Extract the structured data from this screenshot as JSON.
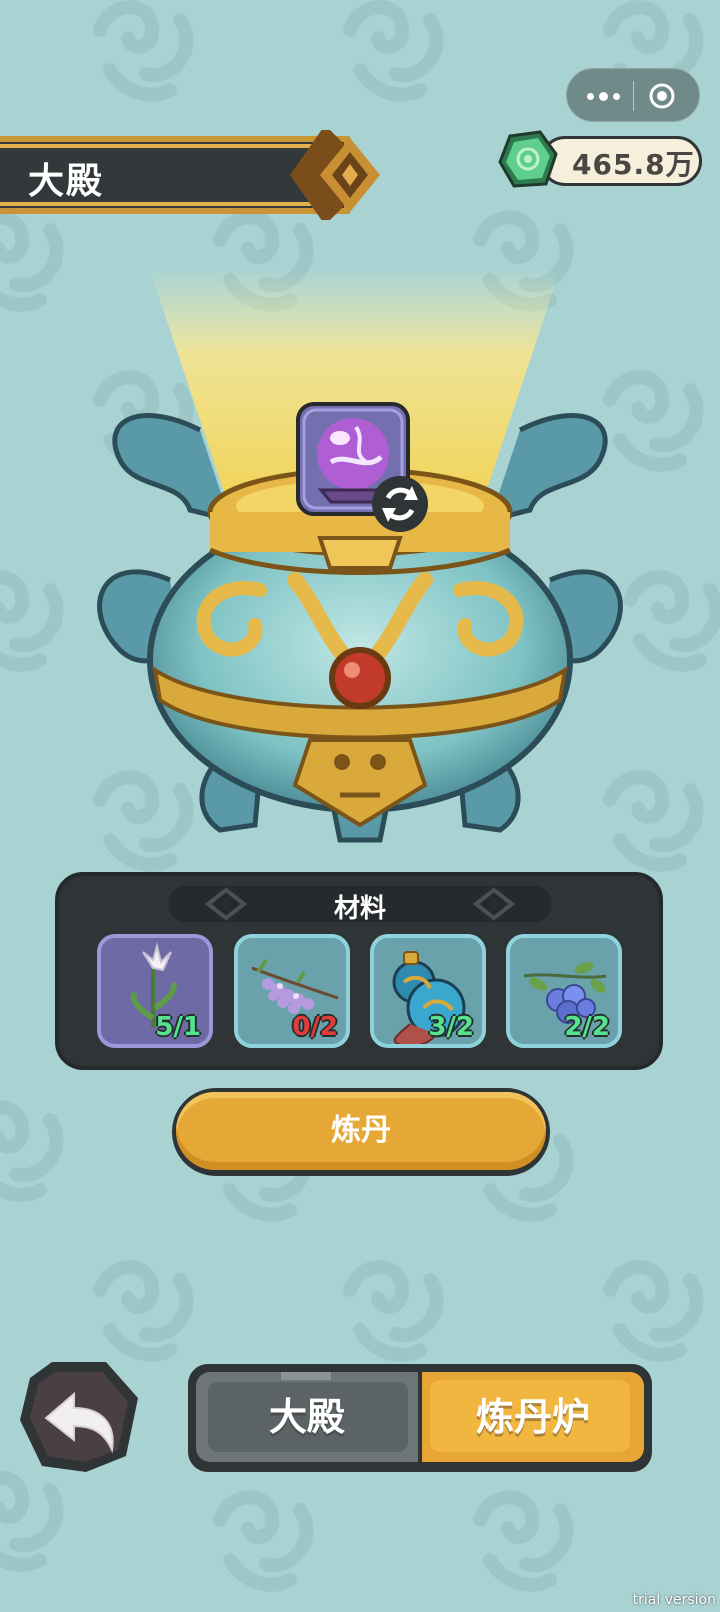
{
  "header": {
    "title": "大殿"
  },
  "capsule": {
    "more_icon": "more-dots-icon",
    "close_icon": "target-circle-icon"
  },
  "currency": {
    "value": "465.8万",
    "icon": "jade-gem-icon"
  },
  "furnace": {
    "pill_icon": "purple-pill-orb-icon",
    "swap_icon": "refresh-swap-icon"
  },
  "materials": {
    "title": "材料",
    "items": [
      {
        "icon": "white-lily-herb-icon",
        "count": "5/1",
        "count_color": "#56e38f",
        "frame": "purple"
      },
      {
        "icon": "wisteria-flower-icon",
        "count": "0/2",
        "count_color": "#e23b3b",
        "frame": "teal"
      },
      {
        "icon": "blue-gourd-bottle-icon",
        "count": "3/2",
        "count_color": "#56e38f",
        "frame": "teal"
      },
      {
        "icon": "blue-berry-branch-icon",
        "count": "2/2",
        "count_color": "#56e38f",
        "frame": "teal"
      }
    ]
  },
  "brew_button": {
    "label": "炼丹"
  },
  "back_button": {
    "icon": "back-arrow-icon"
  },
  "tabs": [
    {
      "label": "大殿",
      "active": false
    },
    {
      "label": "炼丹炉",
      "active": true
    }
  ],
  "watermark": "trial version",
  "colors": {
    "background": "#a9d3d2",
    "accent": "#e5a735",
    "panel": "#2f3537"
  }
}
